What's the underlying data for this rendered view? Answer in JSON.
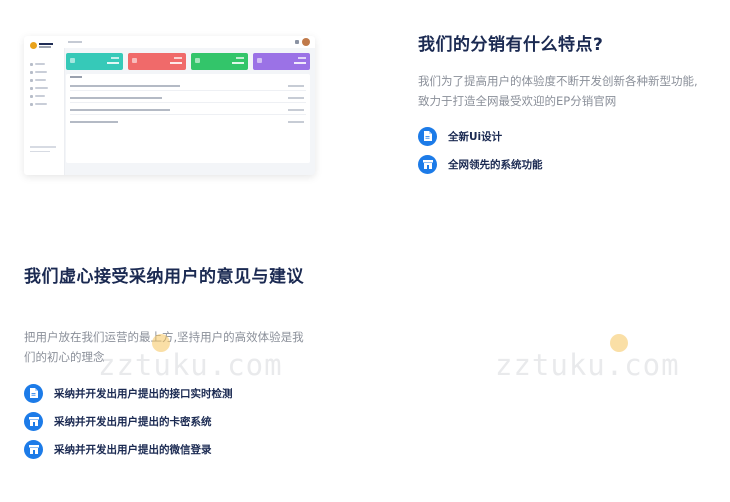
{
  "preview": {
    "card_colors": [
      "#36c9b8",
      "#f06a6a",
      "#33c56a",
      "#9b72e6"
    ],
    "brand_color": "#1b2a52"
  },
  "section_features": {
    "title": "我们的分销有什么特点?",
    "description": "我们为了提高用户的体验度不断开发创新各种新型功能,致力于打造全网最受欢迎的EP分销官网",
    "items": [
      {
        "label": "全新Ui设计",
        "icon": "document-icon"
      },
      {
        "label": "全网领先的系统功能",
        "icon": "shop-icon"
      }
    ]
  },
  "section_feedback": {
    "title": "我们虚心接受采纳用户的意见与建议",
    "description": "把用户放在我们运营的最上方,坚持用户的高效体验是我们的初心的理念",
    "items": [
      {
        "label": "采纳并开发出用户提出的接口实时检测",
        "icon": "document-icon"
      },
      {
        "label": "采纳并开发出用户提出的卡密系统",
        "icon": "shop-icon"
      },
      {
        "label": "采纳并开发出用户提出的微信登录",
        "icon": "shop-icon"
      }
    ]
  },
  "accent_color": "#1c7be8",
  "watermark": "zztuku.com"
}
